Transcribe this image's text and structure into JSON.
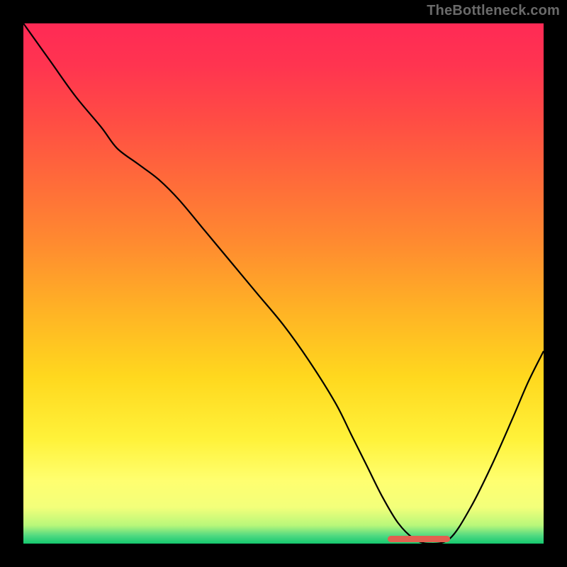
{
  "watermark": "TheBottleneck.com",
  "colors": {
    "background": "#000000",
    "watermark_text": "#6a6a6a",
    "curve": "#000000",
    "marker": "#e2604f",
    "gradient_stops": [
      {
        "offset": 0.0,
        "color": "#ff2a55"
      },
      {
        "offset": 0.08,
        "color": "#ff3450"
      },
      {
        "offset": 0.18,
        "color": "#ff4b45"
      },
      {
        "offset": 0.3,
        "color": "#ff6a3a"
      },
      {
        "offset": 0.42,
        "color": "#ff8a30"
      },
      {
        "offset": 0.55,
        "color": "#ffb225"
      },
      {
        "offset": 0.68,
        "color": "#ffd81e"
      },
      {
        "offset": 0.8,
        "color": "#fff23a"
      },
      {
        "offset": 0.88,
        "color": "#ffff70"
      },
      {
        "offset": 0.93,
        "color": "#f3ff7a"
      },
      {
        "offset": 0.965,
        "color": "#b8f77a"
      },
      {
        "offset": 0.985,
        "color": "#4fd981"
      },
      {
        "offset": 1.0,
        "color": "#15c96f"
      }
    ]
  },
  "chart_data": {
    "type": "line",
    "title": "",
    "xlabel": "",
    "ylabel": "",
    "xlim": [
      0,
      100
    ],
    "ylim": [
      0,
      100
    ],
    "grid": false,
    "series": [
      {
        "name": "bottleneck-curve",
        "x": [
          0,
          5,
          10,
          15,
          18,
          22,
          26,
          30,
          35,
          40,
          45,
          50,
          55,
          60,
          63,
          66,
          69,
          72,
          75,
          78,
          82,
          86,
          90,
          94,
          97,
          100
        ],
        "y": [
          100,
          93,
          86,
          80,
          76,
          73,
          70,
          66,
          60,
          54,
          48,
          42,
          35,
          27,
          21,
          15,
          9,
          4,
          1,
          0,
          1,
          7,
          15,
          24,
          31,
          37
        ]
      }
    ],
    "annotations": [
      {
        "name": "optimal-range",
        "x_start": 70,
        "x_end": 82,
        "y": 0
      }
    ]
  }
}
